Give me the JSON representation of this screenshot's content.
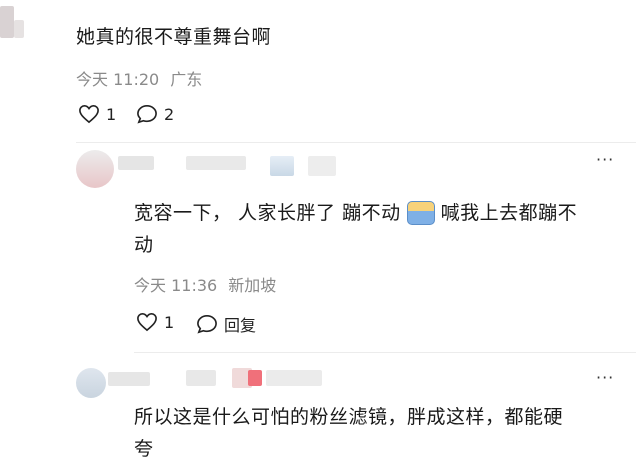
{
  "comments": [
    {
      "text": "她真的很不尊重舞台啊",
      "time": "今天 11:20",
      "location": "广东",
      "like_count": "1",
      "reply_count": "2"
    },
    {
      "text_line1": "宽容一下，  人家长胖了 蹦不动",
      "text_line1b": "喊我上去都蹦不",
      "text_line2": "动",
      "emoji": "emoji-sticker",
      "time": "今天 11:36",
      "location": "新加坡",
      "like_count": "1",
      "reply_label": "回复"
    },
    {
      "text_line1": "所以这是什么可怕的粉丝滤镜，胖成这样，都能硬",
      "text_line2": "夸"
    }
  ],
  "icons": {
    "like": "heart-outline-icon",
    "reply": "speech-bubble-icon",
    "more": "more-dots-icon"
  },
  "colors": {
    "meta_text": "#8a8a8a",
    "divider": "#ececec"
  }
}
